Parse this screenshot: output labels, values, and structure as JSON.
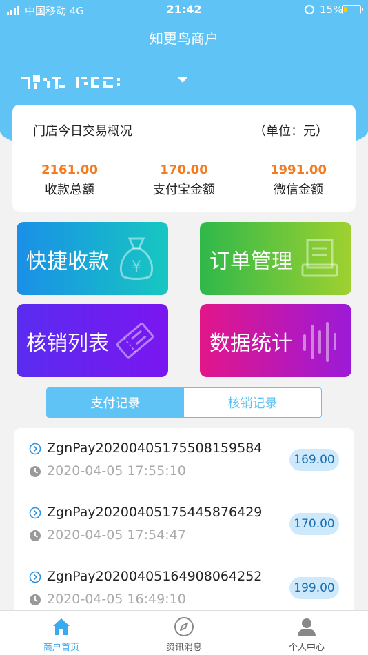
{
  "status_bar": {
    "carrier": "中国移动  4G",
    "time": "21:42",
    "battery_percent": "15%"
  },
  "header": {
    "title": "知更鸟商户",
    "store_name_obscured": true
  },
  "summary": {
    "title": "门店今日交易概况",
    "unit": "（单位：元）",
    "stats": [
      {
        "value": "2161.00",
        "label": "收款总额"
      },
      {
        "value": "170.00",
        "label": "支付宝金额"
      },
      {
        "value": "1991.00",
        "label": "微信金额"
      }
    ]
  },
  "tiles": [
    {
      "label": "快捷收款",
      "icon": "money-bag-icon"
    },
    {
      "label": "订单管理",
      "icon": "receipt-printer-icon"
    },
    {
      "label": "核销列表",
      "icon": "ticket-icon"
    },
    {
      "label": "数据统计",
      "icon": "bar-lines-icon"
    }
  ],
  "segment": {
    "tabs": [
      "支付记录",
      "核销记录"
    ],
    "active_index": 0
  },
  "records": [
    {
      "order_id": "ZgnPay20200405175508159584",
      "time": "2020-04-05 17:55:10",
      "amount": "169.00"
    },
    {
      "order_id": "ZgnPay20200405175445876429",
      "time": "2020-04-05 17:54:47",
      "amount": "170.00"
    },
    {
      "order_id": "ZgnPay20200405164908064252",
      "time": "2020-04-05 16:49:10",
      "amount": "199.00"
    }
  ],
  "tabbar": {
    "items": [
      {
        "label": "商户首页",
        "icon": "home-icon",
        "active": true
      },
      {
        "label": "资讯消息",
        "icon": "compass-icon",
        "active": false
      },
      {
        "label": "个人中心",
        "icon": "person-icon",
        "active": false
      }
    ]
  },
  "colors": {
    "header_blue": "#5fc4f5",
    "amount_orange": "#f47b20",
    "active_tab": "#3aaaf0"
  }
}
